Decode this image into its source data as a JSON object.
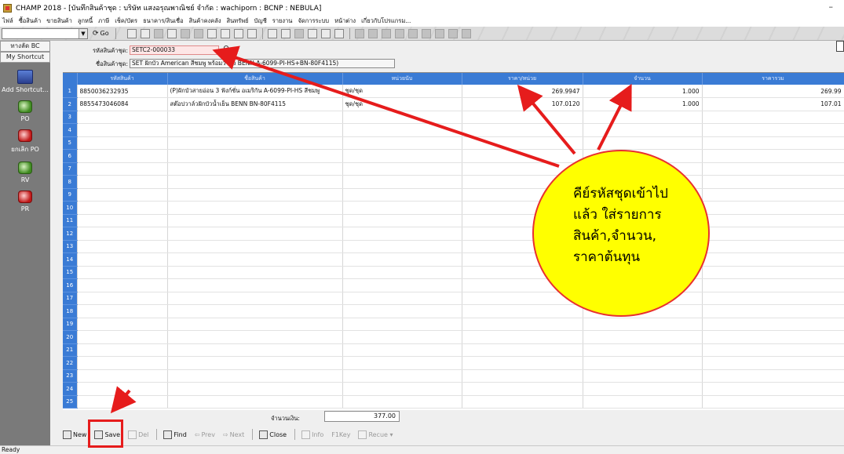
{
  "window": {
    "title": "CHAMP 2018 - [บันทึกสินค้าชุด : บริษัท แสงอรุณพาณิชย์ จำกัด : wachiporn : BCNP : NEBULA]",
    "minimize": "–"
  },
  "menu": [
    "ไฟล์",
    "ซื้อสินค้า",
    "ขายสินค้า",
    "ลูกหนี้",
    "ภาษี",
    "เช็ค/บัตร",
    "ธนาคาร/สินเชื่อ",
    "สินค้าคงคลัง",
    "สินทรัพย์",
    "บัญชี",
    "รายงาน",
    "จัดการระบบ",
    "หน้าต่าง",
    "เกี่ยวกับโปรแกรม..."
  ],
  "toolbar": {
    "combo_value": "",
    "go_label": "Go"
  },
  "sidebar": {
    "tab_bc": "ทางลัด BC",
    "tab_shortcut": "My Shortcut",
    "add_shortcut": "Add Shortcut...",
    "items": [
      {
        "label": "PO",
        "icon": "green-document-icon"
      },
      {
        "label": "ยกเลิก PO",
        "icon": "red-document-icon"
      },
      {
        "label": "RV",
        "icon": "green-document-icon"
      },
      {
        "label": "PR",
        "icon": "red-document-icon"
      }
    ]
  },
  "form": {
    "code_label": "รหัสสินค้าชุด:",
    "code_value": "SETC2-000033",
    "name_label": "ชื่อสินค้าชุด:",
    "name_value": "SET ฝักบัว American สีชมพู พร้อมวาล์ว BENN A-6099-PI-HS+BN-80F4115)"
  },
  "grid": {
    "headers": [
      "",
      "รหัสสินค้า",
      "ชื่อสินค้า",
      "หน่วยนับ",
      "ราคา/หน่วย",
      "จำนวน",
      "ราคารวม"
    ],
    "rows": [
      {
        "no": "1",
        "code": "8850036232935",
        "name": "(P)ฝักบัวสายอ่อน 3 ฟังก์ชั่น อเมริกัน A-6099-PI-HS สีชมพู",
        "unit": "ชุด/ชุด",
        "price": "269.9947",
        "qty": "1.000",
        "total": "269.99"
      },
      {
        "no": "2",
        "code": "8855473046084",
        "name": "สต๊อปวาล์วฝักบัวน้ำเย็น BENN BN-80F4115",
        "unit": "ชุด/ชุด",
        "price": "107.0120",
        "qty": "1.000",
        "total": "107.01"
      },
      {
        "no": "3",
        "code": "",
        "name": "",
        "unit": "",
        "price": "",
        "qty": "",
        "total": ""
      },
      {
        "no": "4",
        "code": "",
        "name": "",
        "unit": "",
        "price": "",
        "qty": "",
        "total": ""
      },
      {
        "no": "5",
        "code": "",
        "name": "",
        "unit": "",
        "price": "",
        "qty": "",
        "total": ""
      },
      {
        "no": "6",
        "code": "",
        "name": "",
        "unit": "",
        "price": "",
        "qty": "",
        "total": ""
      },
      {
        "no": "7",
        "code": "",
        "name": "",
        "unit": "",
        "price": "",
        "qty": "",
        "total": ""
      },
      {
        "no": "8",
        "code": "",
        "name": "",
        "unit": "",
        "price": "",
        "qty": "",
        "total": ""
      },
      {
        "no": "9",
        "code": "",
        "name": "",
        "unit": "",
        "price": "",
        "qty": "",
        "total": ""
      },
      {
        "no": "10",
        "code": "",
        "name": "",
        "unit": "",
        "price": "",
        "qty": "",
        "total": ""
      },
      {
        "no": "11",
        "code": "",
        "name": "",
        "unit": "",
        "price": "",
        "qty": "",
        "total": ""
      },
      {
        "no": "12",
        "code": "",
        "name": "",
        "unit": "",
        "price": "",
        "qty": "",
        "total": ""
      },
      {
        "no": "13",
        "code": "",
        "name": "",
        "unit": "",
        "price": "",
        "qty": "",
        "total": ""
      },
      {
        "no": "14",
        "code": "",
        "name": "",
        "unit": "",
        "price": "",
        "qty": "",
        "total": ""
      },
      {
        "no": "15",
        "code": "",
        "name": "",
        "unit": "",
        "price": "",
        "qty": "",
        "total": ""
      },
      {
        "no": "16",
        "code": "",
        "name": "",
        "unit": "",
        "price": "",
        "qty": "",
        "total": ""
      },
      {
        "no": "17",
        "code": "",
        "name": "",
        "unit": "",
        "price": "",
        "qty": "",
        "total": ""
      },
      {
        "no": "18",
        "code": "",
        "name": "",
        "unit": "",
        "price": "",
        "qty": "",
        "total": ""
      },
      {
        "no": "19",
        "code": "",
        "name": "",
        "unit": "",
        "price": "",
        "qty": "",
        "total": ""
      },
      {
        "no": "20",
        "code": "",
        "name": "",
        "unit": "",
        "price": "",
        "qty": "",
        "total": ""
      },
      {
        "no": "21",
        "code": "",
        "name": "",
        "unit": "",
        "price": "",
        "qty": "",
        "total": ""
      },
      {
        "no": "22",
        "code": "",
        "name": "",
        "unit": "",
        "price": "",
        "qty": "",
        "total": ""
      },
      {
        "no": "23",
        "code": "",
        "name": "",
        "unit": "",
        "price": "",
        "qty": "",
        "total": ""
      },
      {
        "no": "24",
        "code": "",
        "name": "",
        "unit": "",
        "price": "",
        "qty": "",
        "total": ""
      },
      {
        "no": "25",
        "code": "",
        "name": "",
        "unit": "",
        "price": "",
        "qty": "",
        "total": ""
      }
    ]
  },
  "footer": {
    "total_label": "จำนวนเงิน:",
    "total_value": "377.00"
  },
  "buttons": {
    "new": "New",
    "save": "Save",
    "del": "Del",
    "find": "Find",
    "prev": "Prev",
    "next": "Next",
    "close": "Close",
    "info": "Info",
    "f1key": "F1Key",
    "recue": "Recue ▾"
  },
  "status": "Ready",
  "annotation": {
    "lines": [
      "คีย์รหัสชุดเข้าไป",
      "แล้ว ใส่รายการ",
      "สินค้า,จำนวน,",
      "ราคาต้นทุน"
    ],
    "color_fill": "#ffff00",
    "color_border": "#e83030",
    "color_arrow": "#e61c1c"
  }
}
